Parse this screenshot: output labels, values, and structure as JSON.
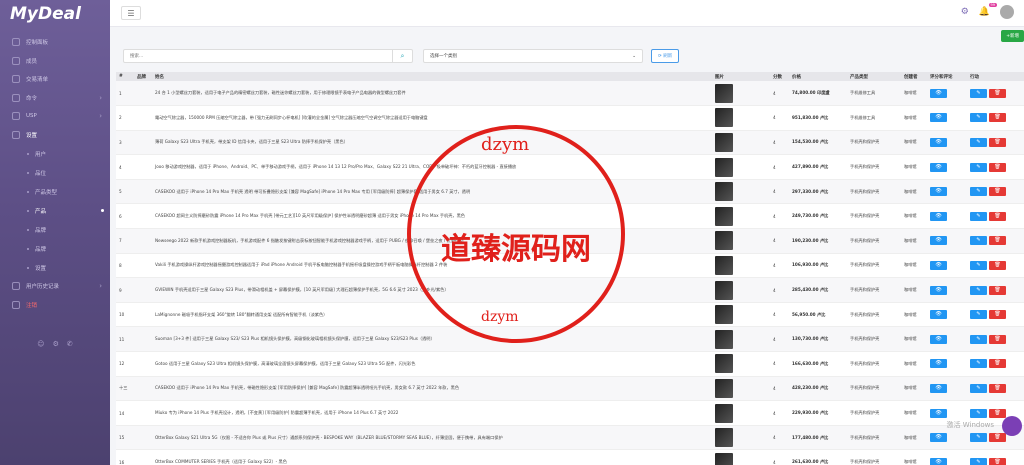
{
  "app": {
    "logo": "MyDeal"
  },
  "sidebar": {
    "items": [
      {
        "label": "控制面板",
        "type": "top"
      },
      {
        "label": "成员",
        "type": "top"
      },
      {
        "label": "交易清单",
        "type": "top"
      },
      {
        "label": "命令",
        "type": "top",
        "chev": true
      },
      {
        "label": "USP",
        "type": "top",
        "chev": true
      },
      {
        "label": "设置",
        "type": "top",
        "open": true
      },
      {
        "label": "用户",
        "type": "sub"
      },
      {
        "label": "品位",
        "type": "sub"
      },
      {
        "label": "产品类型",
        "type": "sub"
      },
      {
        "label": "产品",
        "type": "sub",
        "active": true
      },
      {
        "label": "品牌",
        "type": "sub"
      },
      {
        "label": "品牌",
        "type": "sub"
      },
      {
        "label": "设置",
        "type": "sub"
      },
      {
        "label": "用户历史记录",
        "type": "top",
        "chev": true
      },
      {
        "label": "注销",
        "type": "top",
        "logout": true
      }
    ]
  },
  "topbar": {
    "notifications": "99"
  },
  "toolbar": {
    "add_label": "+新增",
    "search_placeholder": "搜索...",
    "category_placeholder": "选择一个类别",
    "refresh_label": "刷新"
  },
  "table": {
    "headers": [
      "#",
      "品牌",
      "姓名",
      "图片",
      "分数",
      "价格",
      "产品类型",
      "创建者",
      "评分和评论",
      "行动"
    ],
    "rows": [
      {
        "id": "1",
        "name": "24 合 1 小型螺丝刀套装，适用于电子产品的精密螺丝刀套装，磁性迷你螺丝刀套装，用于修理眼镜手表电子产品电器的微型螺丝刀套件",
        "score": "4",
        "price": "74,800.00 印度盧",
        "type": "手机维修工具",
        "creator": "咖啡馆"
      },
      {
        "id": "2",
        "name": "電动空气除尘器，150000 RPM 压缩空气除尘器，带 [强力无刷同步心杯电机] [吹灌的全金属] 空气除尘器压缩空气空调空气除尘器适用于电脑键盘",
        "score": "4",
        "price": "951,830.00 卢比",
        "type": "手机维修工具",
        "creator": "咖啡馆"
      },
      {
        "id": "3",
        "name": "薄荷 Galaxy S23 Ultra 手机壳，带支架 ID 信用卡夹，适用于三星 S23 Ultra 防摔手机保护壳（黑色）",
        "score": "4",
        "price": "154,530.00 卢比",
        "type": "手机壳和保护壳",
        "creator": "咖啡馆"
      },
      {
        "id": "4",
        "name": "Jooo 移动游戏控制器，适用于 iPhone、Android、PC、单手移动游戏手柄，适用于 iPhone 14 13 12 Pro/Pro Max、Galaxy S22 21 Ultra、COD、吸单破坏神：不朽的蓝牙控制器 - 直接播放",
        "score": "4",
        "price": "427,890.00 卢比",
        "type": "手机壳和保护壳",
        "creator": "咖啡馆"
      },
      {
        "id": "5",
        "name": "CASEKOO 适用于 iPhone 14 Pro Max 手机壳 透明 带可折叠隐形支架 [兼容 MagSafe] iPhone 14 Pro Max 专用 [军用级防摔] 超薄保护套 适用于男女 6.7 英寸，透明",
        "score": "4",
        "price": "297,330.00 卢比",
        "type": "手机壳和保护壳",
        "creator": "咖啡馆"
      },
      {
        "id": "6",
        "name": "CASEKOO 超岡主义防摔磨砂防震 iPhone 14 Pro Max 手机壳 [带元工艺][10 英尺军用级保护] 保护性半透明磨砂超薄 适用于男女 iPhone 14 Pro Max 手机壳，黑色",
        "score": "4",
        "price": "249,730.00 卢比",
        "type": "手机壳和保护壳",
        "creator": "咖啡馆"
      },
      {
        "id": "7",
        "name": "Newseego 2022 新款手机游戏控制器板机，手机游戏配件 6 指触发按键射击获标按钮智能手机游戏控制器游戏手柄，适用于 PUBG / 使命召唤 / 堡垒之夜 / 荒野行动",
        "score": "4",
        "price": "190,230.00 卢比",
        "type": "手机壳和保护壳",
        "creator": "咖啡馆"
      },
      {
        "id": "8",
        "name": "Vakili 手机游戏操纵杆游戏控制器摇摄游戏控制器适用于 iPad iPhone Android 手机平板电脑控制器手机摇杆吸盘操控游戏手柄平板电脑操纵杆控制器 2 件装",
        "score": "4",
        "price": "106,930.00 卢比",
        "type": "手机壳和保护壳",
        "creator": "咖啡馆"
      },
      {
        "id": "9",
        "name": "GVIEWIN 手机壳适用于三星 Galaxy S23 Plus，带滑动相机盖 + 屏幕保护膜，[10 英尺军用级] 大理石超薄保护手机壳，5G 6.6 英寸 2023（梦乡光/紫色）",
        "score": "4",
        "price": "285,430.00 卢比",
        "type": "手机壳和保护壳",
        "creator": "咖啡馆"
      },
      {
        "id": "10",
        "name": "LaMignonne 磁吸手机指环支架 360°旋转 180°翻转通用支架 适配所有智能手机（淡紫色）",
        "score": "4",
        "price": "56,950.00 卢比",
        "type": "手机壳和保护壳",
        "creator": "咖啡馆"
      },
      {
        "id": "11",
        "name": "Suoman [3+3 件] 适用于三星 Galaxy S23/ S23 Plus 相机镜头保护膜，高级钢化玻璃相机镜头保护膜，适用于三星 Galaxy S23/S23 Plus（透明）",
        "score": "4",
        "price": "130,730.00 卢比",
        "type": "手机壳和保护壳",
        "creator": "咖啡馆"
      },
      {
        "id": "12",
        "name": "Gotoo 适用于三星 Galaxy S23 Ultra 相机镜头保护膜，高清玻璃全面镜头屏幕保护膜，适用于三星 Galaxy S23 Ultra 5G 配件，闪光彩色",
        "score": "4",
        "price": "166,630.00 卢比",
        "type": "手机壳和保护壳",
        "creator": "咖啡馆"
      },
      {
        "id": "十三",
        "name": "CASEKOO 适用于 iPhone 14 Pro Max 手机壳，带磁性隐形支架 [军用防摔保护] [兼容 MagSafe] 防震超薄半透明哑光手机壳，男女款 6.7 英寸 2022 年款，黑色",
        "score": "4",
        "price": "428,230.00 卢比",
        "type": "手机壳和保护壳",
        "creator": "咖啡馆"
      },
      {
        "id": "14",
        "name": "Miuko 专为 iPhone 14 Plus 手机壳设计，透明，[不变黄] [军用级防护] 防震超薄手机壳，适用于 iPhone 14 Plus 6.7 英寸 2022",
        "score": "4",
        "price": "229,930.00 卢比",
        "type": "手机壳和保护壳",
        "creator": "咖啡馆"
      },
      {
        "id": "15",
        "name": "OtterBox Galaxy S21 Ultra 5G（仅限 - 不适合你 Plus 或 Plus 尺寸）通颜系列保护壳 - BESPOKE WAY（BLAZER BLUE/STORMY SEAS BLUE），纤薄坚固，便于携带，具有端口保护",
        "score": "4",
        "price": "177,480.00 卢比",
        "type": "手机壳和保护壳",
        "creator": "咖啡馆"
      },
      {
        "id": "16",
        "name": "OtterBox COMMUTER SERIES 手机壳（适用于 Galaxy S22）- 黑色",
        "score": "4",
        "price": "261,630.00 卢比",
        "type": "手机壳和保护壳",
        "creator": "咖啡馆"
      }
    ]
  },
  "watermark": {
    "text": "道臻源码网",
    "url_top": "dzym",
    "url_bottom": "dzym"
  },
  "windows_activate": "激活 Windows",
  "colors": {
    "sidebar": "#5d4f86",
    "primary": "#2196f3",
    "danger": "#e53935",
    "success": "#28a745",
    "watermark": "#e0201b"
  }
}
